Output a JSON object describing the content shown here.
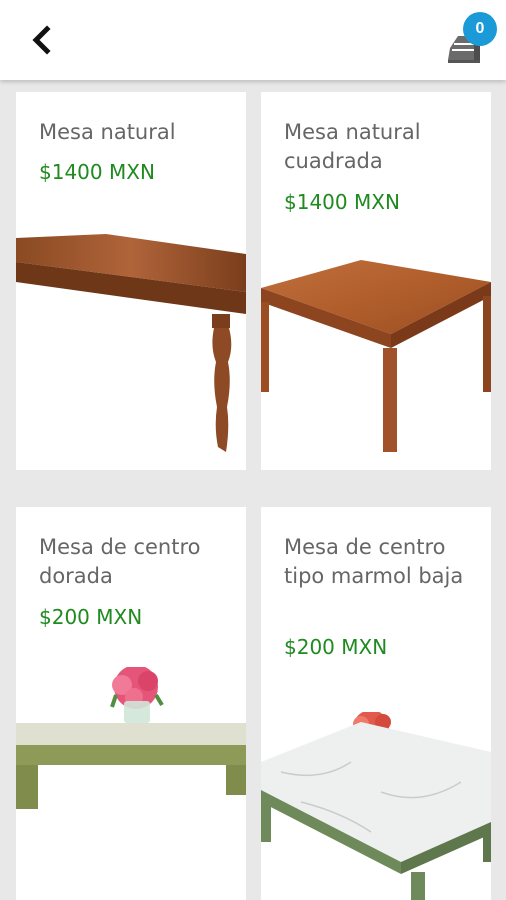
{
  "header": {
    "back_icon": "chevron-left-icon",
    "cart_icon": "cart-box-icon",
    "cart_count": "0",
    "badge_color": "#1a9ad6"
  },
  "products": [
    {
      "name": "Mesa natural",
      "price": "$1400 MXN",
      "image": "wooden-table-photo"
    },
    {
      "name": "Mesa natural cuadrada",
      "price": "$1400 MXN",
      "image": "square-wooden-table-photo"
    },
    {
      "name": "Mesa de centro dorada",
      "price": "$200 MXN",
      "image": "gold-coffee-table-photo"
    },
    {
      "name": "Mesa de centro tipo marmol baja",
      "price": "$200 MXN",
      "image": "marble-coffee-table-photo"
    }
  ],
  "colors": {
    "price": "#1f8a1f",
    "title": "#666666",
    "background": "#e8e8e8"
  }
}
